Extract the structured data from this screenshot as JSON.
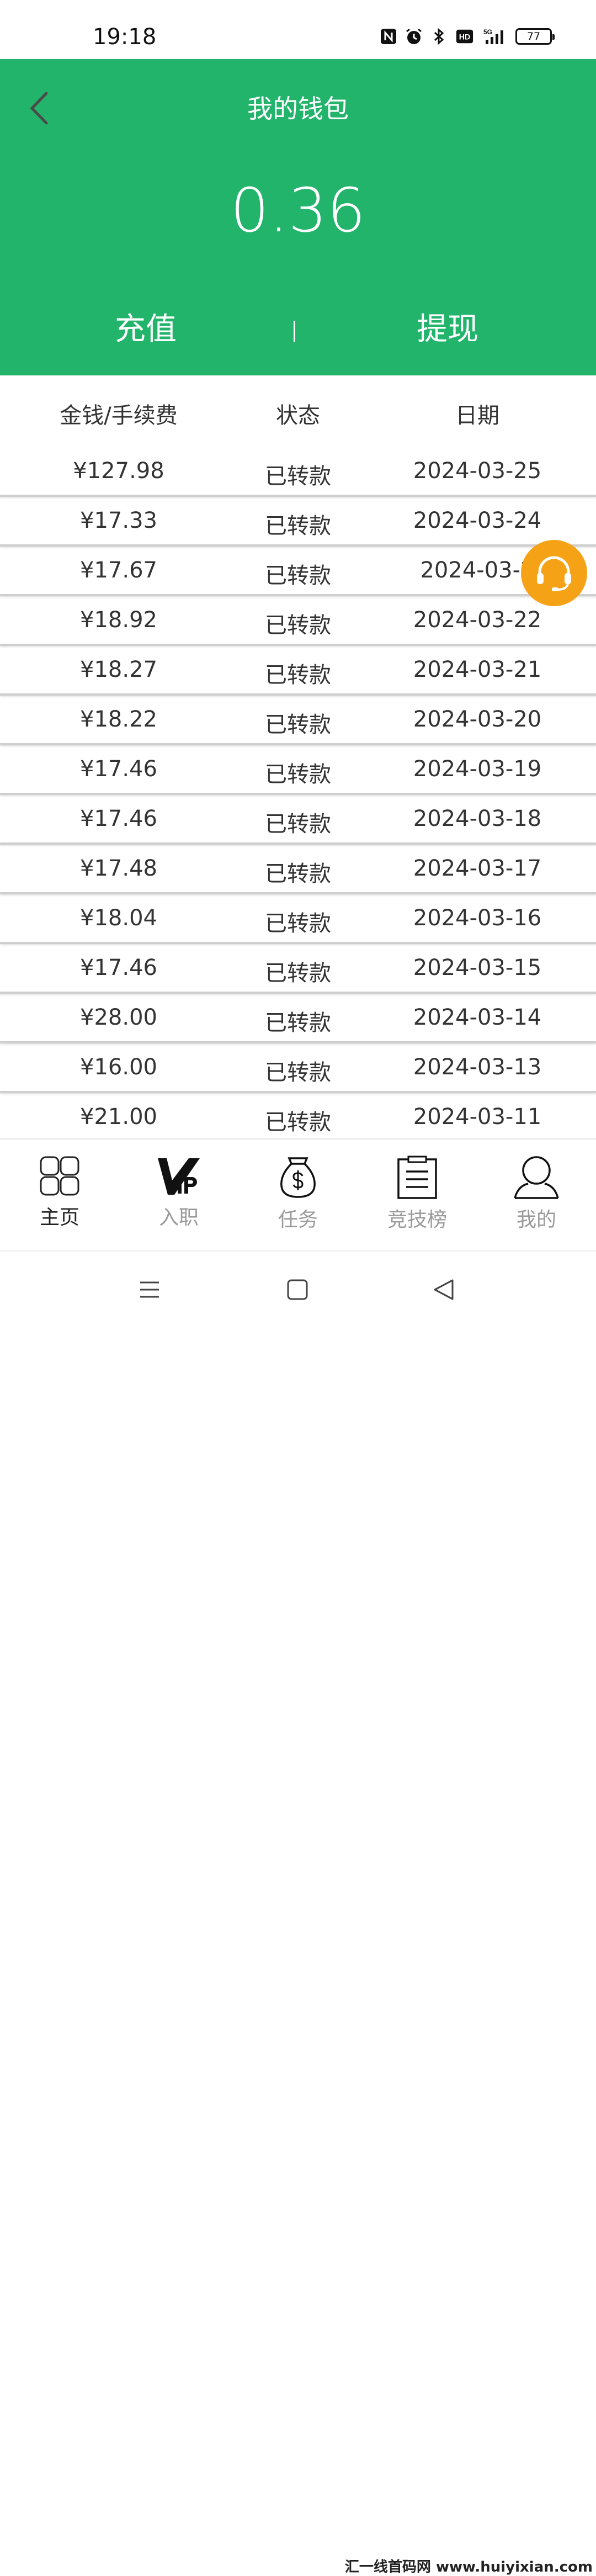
{
  "status_bar": {
    "time": "19:18",
    "battery": "77",
    "icons": [
      "nfc-icon",
      "alarm-icon",
      "bluetooth-icon",
      "hd-icon",
      "5g-signal-icon",
      "battery-icon"
    ],
    "hd_label": "HD",
    "net_label": "5G"
  },
  "header": {
    "title": "我的钱包",
    "balance": "0.36",
    "recharge_label": "充值",
    "withdraw_label": "提现",
    "bg_color": "#23b46c"
  },
  "table": {
    "headers": [
      "金钱/手续费",
      "状态",
      "日期"
    ],
    "rows": [
      {
        "amount": "¥127.98",
        "status": "已转款",
        "date": "2024-03-25"
      },
      {
        "amount": "¥17.33",
        "status": "已转款",
        "date": "2024-03-24"
      },
      {
        "amount": "¥17.67",
        "status": "已转款",
        "date": "2024-03-2"
      },
      {
        "amount": "¥18.92",
        "status": "已转款",
        "date": "2024-03-22"
      },
      {
        "amount": "¥18.27",
        "status": "已转款",
        "date": "2024-03-21"
      },
      {
        "amount": "¥18.22",
        "status": "已转款",
        "date": "2024-03-20"
      },
      {
        "amount": "¥17.46",
        "status": "已转款",
        "date": "2024-03-19"
      },
      {
        "amount": "¥17.46",
        "status": "已转款",
        "date": "2024-03-18"
      },
      {
        "amount": "¥17.48",
        "status": "已转款",
        "date": "2024-03-17"
      },
      {
        "amount": "¥18.04",
        "status": "已转款",
        "date": "2024-03-16"
      },
      {
        "amount": "¥17.46",
        "status": "已转款",
        "date": "2024-03-15"
      },
      {
        "amount": "¥28.00",
        "status": "已转款",
        "date": "2024-03-14"
      },
      {
        "amount": "¥16.00",
        "status": "已转款",
        "date": "2024-03-13"
      },
      {
        "amount": "¥21.00",
        "status": "已转款",
        "date": "2024-03-11"
      }
    ]
  },
  "fab": {
    "icon": "headset-icon",
    "color": "#f5a217"
  },
  "bottom_nav": [
    {
      "label": "主页",
      "icon": "grid-icon",
      "active": true
    },
    {
      "label": "入职",
      "icon": "vip-icon",
      "active": false
    },
    {
      "label": "任务",
      "icon": "money-bag-icon",
      "active": false
    },
    {
      "label": "竞技榜",
      "icon": "clipboard-icon",
      "active": false
    },
    {
      "label": "我的",
      "icon": "user-icon",
      "active": false
    }
  ],
  "watermark": "汇一线首码网 www.huiyixian.com"
}
